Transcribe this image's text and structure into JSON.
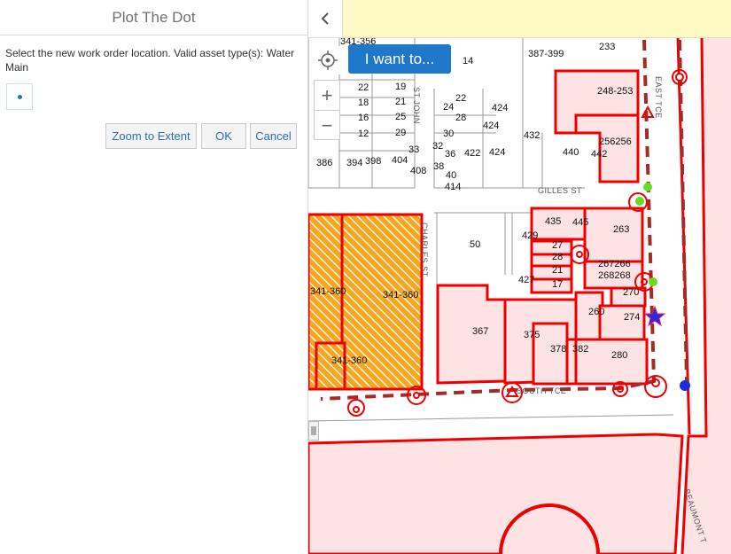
{
  "panel": {
    "title": "Plot The Dot",
    "instructions": "Select the new work order location. Valid asset type(s): Water Main",
    "buttons": {
      "zoom_to_extent": "Zoom to Extent",
      "ok": "OK",
      "cancel": "Cancel"
    }
  },
  "map": {
    "i_want_to": "I want to...",
    "zoom_in": "+",
    "zoom_out": "−",
    "colors": {
      "banner": "#fff9c6",
      "parcel_outline": "#ee0000",
      "parcel_fill": "#fde3e3",
      "hatch": "#f5a623",
      "pipe": "#a52a2a",
      "button_blue": "#1f77c9"
    },
    "streets": [
      "GILLES ST",
      "SOUTH TCE",
      "EAST TCE",
      "BEAUMONT T",
      "ST JOHN",
      "CHARLES ST"
    ],
    "parcel_labels": [
      "341-356",
      "14",
      "387-399",
      "233",
      "22",
      "19",
      "18",
      "21",
      "16",
      "25",
      "12",
      "29",
      "24",
      "424",
      "28",
      "22",
      "424",
      "30",
      "432",
      "256256",
      "248-253",
      "32",
      "36",
      "422",
      "424",
      "38",
      "33",
      "440",
      "442",
      "404",
      "386",
      "394",
      "398",
      "408",
      "40",
      "414",
      "435",
      "445",
      "263",
      "429",
      "50",
      "27",
      "28",
      "21",
      "267266",
      "268268",
      "17",
      "427",
      "270",
      "260",
      "274",
      "367",
      "375",
      "378",
      "382",
      "280",
      "341-360",
      "341-360",
      "341-360"
    ]
  }
}
